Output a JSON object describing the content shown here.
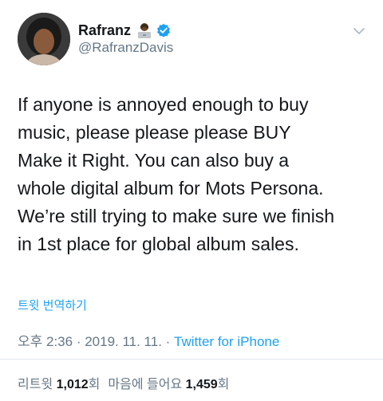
{
  "tweet": {
    "display_name": "Rafranz",
    "emoji_icon": "woman-technologist-emoji-icon",
    "verified_icon": "verified-badge-icon",
    "handle": "@RafranzDavis",
    "menu_icon": "chevron-down-icon",
    "lines": [
      "If anyone is annoyed enough to buy",
      "music, please please please BUY",
      "Make it Right. You can also buy a",
      "whole digital album for Mots Persona.",
      "We’re still trying to make sure we finish",
      "in 1st place for global album sales."
    ],
    "translate_label": "트윗 번역하기",
    "time": "오후 2:36",
    "sep1": " · ",
    "date": "2019. 11. 11.",
    "sep2": " · ",
    "source": "Twitter for iPhone"
  },
  "stats": {
    "retweets_label": "리트윗",
    "retweets_count": "1,012",
    "retweets_unit": "회",
    "likes_label": "마음에 들어요",
    "likes_count": "1,459",
    "likes_unit": "회"
  },
  "colors": {
    "link": "#1da1f2",
    "secondary_text": "#657786",
    "primary_text": "#14171a",
    "divider": "#e1e8ed"
  }
}
